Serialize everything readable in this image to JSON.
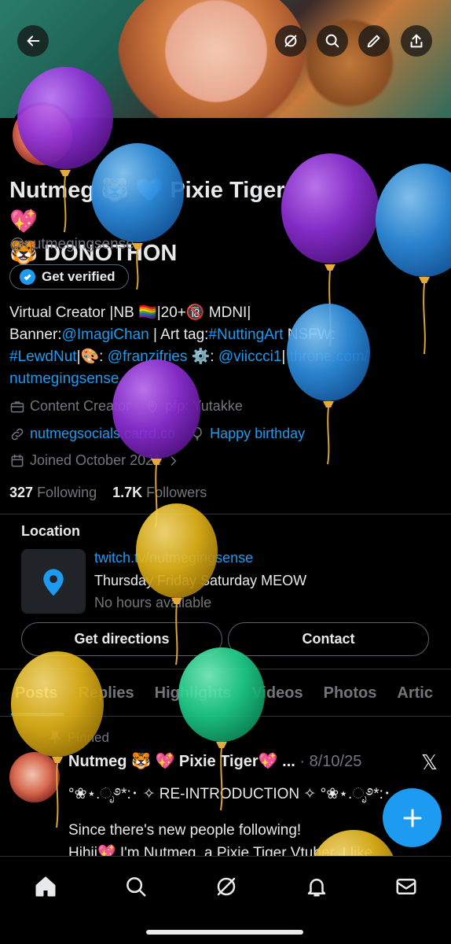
{
  "profile": {
    "display_name": "Nutmeg 🐯 💙 Pixie Tiger 💖",
    "display_name_line2": "🐯 DONOTHON",
    "handle": "@nutmegingsense",
    "verify_label": "Get verified",
    "bio_line1": "Virtual Creator |NB 🏳️‍🌈|20+🔞 MDNI|",
    "bio_banner_prefix": "Banner:",
    "bio_banner_link": "@ImagiChan",
    "bio_tag_prefix": " | Art tag:",
    "bio_tag_link": "#NuttingArt",
    "bio_nsfw": " NSFW:",
    "bio_lewd_link": "#LewdNut",
    "bio_palette": "|🎨: ",
    "bio_fries_link": "@franzifries",
    "bio_gear": " ⚙️: ",
    "bio_vii_link": "@viiccci1",
    "bio_sep": "| ",
    "bio_throne_link": "throne.com/",
    "bio_throne_link2": "nutmegingsense",
    "category": "Content Creator",
    "pfp_credit": "pfp: Yutakke",
    "website": "nutmegsocials.carrd.co",
    "birthday": "Happy birthday",
    "joined": "Joined October 2021",
    "following_count": "327",
    "following_label": "Following",
    "followers_count": "1.7K",
    "followers_label": "Followers"
  },
  "location": {
    "title": "Location",
    "link": "twitch.tv/nutmegingsense",
    "days": "Thursday Friday Saturday MEOW",
    "hours": "No hours available",
    "directions_label": "Get directions",
    "contact_label": "Contact"
  },
  "tabs": [
    "Posts",
    "Replies",
    "Highlights",
    "Videos",
    "Photos",
    "Artic"
  ],
  "post": {
    "pinned_label": "Pinned",
    "author": "Nutmeg 🐯 💖 Pixie Tiger💖 ...",
    "date": " · 8/10/25",
    "line1": "°❀⋆.ೃ࿔*:･ ✧ RE-INTRODUCTION ✧ °❀⋆.ೃ࿔*:･",
    "line2": "Since there's new people following!",
    "line3": "Hihii💖 I'm Nutmeg, a Pixie Tiger Vtuber. I like"
  },
  "icons": {
    "back": "arrow-left-icon",
    "grok": "grok-icon",
    "search": "search-icon",
    "edit": "pencil-icon",
    "share": "share-icon",
    "compose": "plus-icon",
    "home": "home-icon",
    "explore": "search-icon",
    "grok_nav": "grok-icon",
    "notifications": "bell-icon",
    "messages": "mail-icon"
  },
  "colors": {
    "accent": "#1d9bf0",
    "balloon_purple": "#8e2fd6",
    "balloon_blue": "#2f8fe0",
    "balloon_yellow": "#e3b51a",
    "balloon_green": "#1fcf8a"
  }
}
